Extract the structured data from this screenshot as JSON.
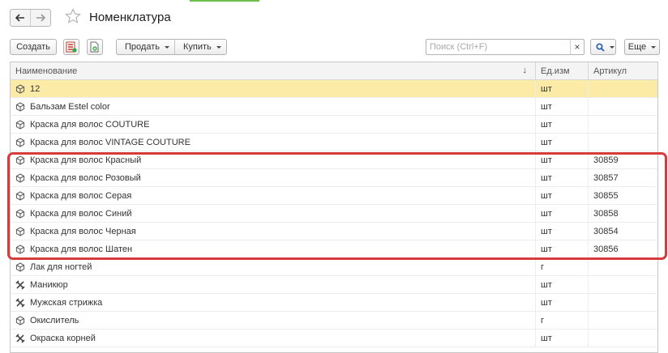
{
  "header": {
    "title": "Номенклатура",
    "back_icon": "arrow-left-icon",
    "forward_icon": "arrow-right-icon",
    "favorite_icon": "star-icon"
  },
  "toolbar": {
    "create_label": "Создать",
    "sell_label": "Продать",
    "buy_label": "Купить",
    "more_label": "Еще",
    "search_placeholder": "Поиск (Ctrl+F)",
    "search_value": "",
    "clear_label": "×"
  },
  "table": {
    "columns": {
      "name": "Наименование",
      "unit": "Ед.изм",
      "sku": "Артикул"
    },
    "sort_indicator": "↓",
    "rows": [
      {
        "name": "12",
        "unit": "шт",
        "sku": "",
        "type": "product",
        "selected": true
      },
      {
        "name": "Бальзам Estel color",
        "unit": "шт",
        "sku": "",
        "type": "product"
      },
      {
        "name": "Краска для волос COUTURE",
        "unit": "шт",
        "sku": "",
        "type": "product"
      },
      {
        "name": "Краска для волос VINTAGE COUTURE",
        "unit": "шт",
        "sku": "",
        "type": "product"
      },
      {
        "name": "Краска для волос Красный",
        "unit": "шт",
        "sku": "30859",
        "type": "product"
      },
      {
        "name": "Краска для волос Розовый",
        "unit": "шт",
        "sku": "30857",
        "type": "product"
      },
      {
        "name": "Краска для волос Серая",
        "unit": "шт",
        "sku": "30855",
        "type": "product"
      },
      {
        "name": "Краска для волос Синий",
        "unit": "шт",
        "sku": "30858",
        "type": "product"
      },
      {
        "name": "Краска для волос Черная",
        "unit": "шт",
        "sku": "30854",
        "type": "product"
      },
      {
        "name": "Краска для волос Шатен",
        "unit": "шт",
        "sku": "30856",
        "type": "product"
      },
      {
        "name": "Лак для ногтей",
        "unit": "г",
        "sku": "",
        "type": "product"
      },
      {
        "name": "Маникюр",
        "unit": "шт",
        "sku": "",
        "type": "service"
      },
      {
        "name": "Мужская стрижка",
        "unit": "шт",
        "sku": "",
        "type": "service"
      },
      {
        "name": "Окислитель",
        "unit": "г",
        "sku": "",
        "type": "product"
      },
      {
        "name": "Окраска корней",
        "unit": "шт",
        "sku": "",
        "type": "service"
      }
    ]
  },
  "colors": {
    "selected_row": "#fbeba6",
    "highlight_frame": "#d63c3c",
    "accent_green": "#6fbf4a"
  }
}
